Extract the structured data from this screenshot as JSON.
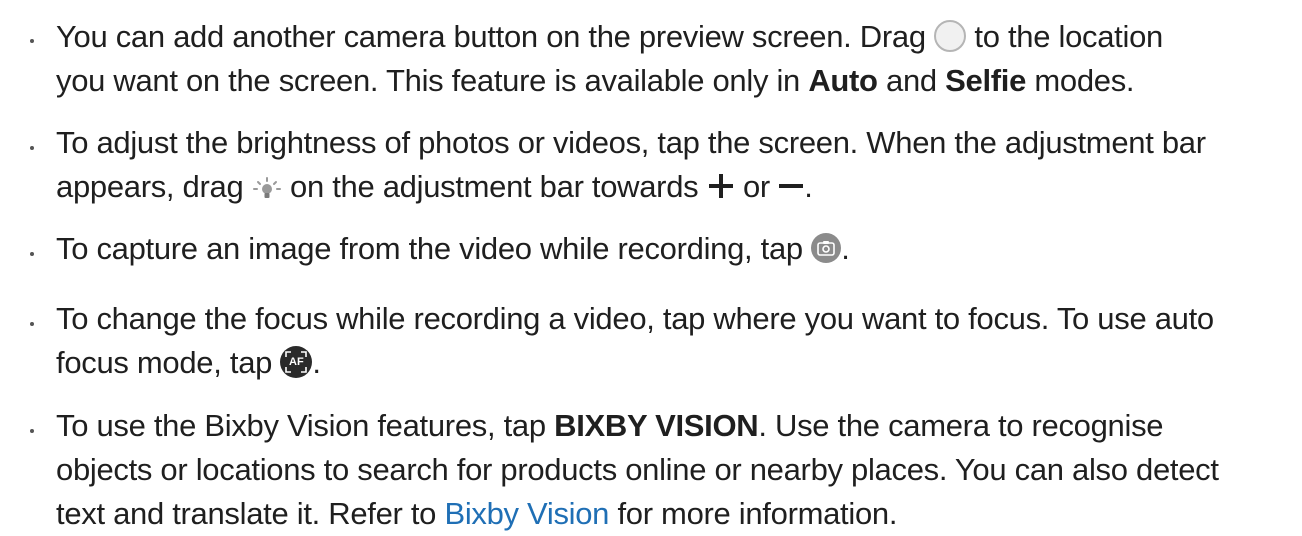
{
  "bullets": [
    {
      "segments": [
        "You can add another camera button on the preview screen. Drag ",
        " to the location",
        "you want on the screen. This feature is available only in ",
        "Auto",
        " and ",
        "Selfie",
        " modes."
      ],
      "icons": [
        "shutter-circle-icon"
      ]
    },
    {
      "segments": [
        "To adjust the brightness of photos or videos, tap the screen. When the adjustment bar",
        "appears, drag ",
        " on the adjustment bar towards ",
        " or ",
        "."
      ],
      "icons": [
        "brightness-bulb-icon",
        "plus-icon",
        "minus-icon"
      ]
    },
    {
      "segments": [
        "To capture an image from the video while recording, tap ",
        "."
      ],
      "icons": [
        "capture-camera-icon"
      ]
    },
    {
      "segments": [
        "To change the focus while recording a video, tap where you want to focus. To use auto",
        "focus mode, tap ",
        "."
      ],
      "icons": [
        "af-autofocus-icon"
      ],
      "af_label": "AF"
    },
    {
      "segments": [
        "To use the Bixby Vision features, tap ",
        "BIXBY VISION",
        ". Use the camera to recognise",
        "objects or locations to search for products online or nearby places. You can also detect",
        "text and translate it. Refer to ",
        "Bixby Vision",
        " for more information."
      ]
    }
  ],
  "colors": {
    "text": "#1f1f1f",
    "link": "#1f6fb5",
    "bullet": "#555555"
  }
}
